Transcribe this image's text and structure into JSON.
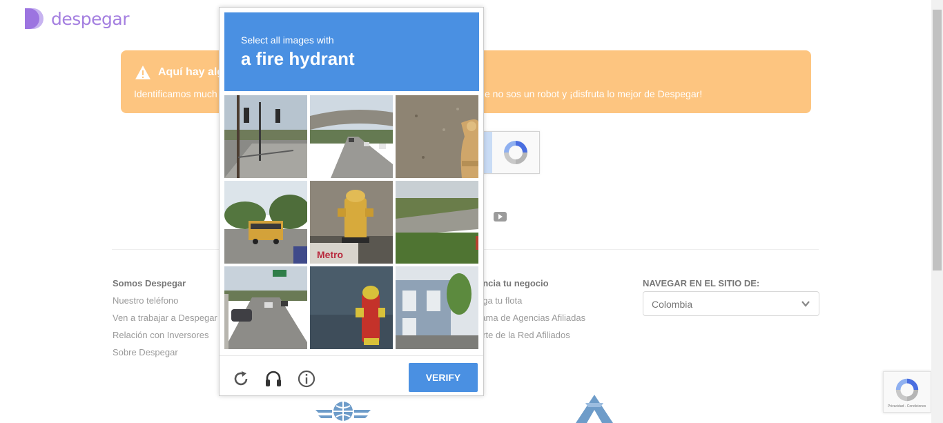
{
  "header": {
    "brand": "despegar",
    "brand_color": "#a47fe0"
  },
  "banner": {
    "title": "Aquí hay alg",
    "text_left": "Identificamos much",
    "text_right": "e no sos un robot y ¡disfruta lo mejor de Despegar!",
    "color": "#fdc580",
    "icon": "warning-icon"
  },
  "footer": {
    "col1": {
      "title": "Somos Despegar",
      "links": [
        "Nuestro teléfono",
        "Ven a trabajar a Despegar",
        "Relación con Inversores",
        "Sobre Despegar"
      ]
    },
    "col2": {
      "title": "encia tu negocio",
      "links": [
        "ega tu flota",
        "rama de Agencias Afiliadas",
        "arte de la Red Afiliados"
      ]
    },
    "col3": {
      "title": "NAVEGAR EN EL SITIO DE:",
      "select_value": "Colombia"
    }
  },
  "captcha": {
    "line1": "Select all images with",
    "line2": "a fire hydrant",
    "verify_label": "VERIFY",
    "tiles": [
      "street-intersection",
      "highway-overpass",
      "fire-hydrant-gravel",
      "school-bus",
      "yellow-fire-hydrant",
      "grass-roadside",
      "highway-cars",
      "red-fire-hydrant",
      "blue-house"
    ],
    "footer_icons": [
      "reload-icon",
      "audio-icon",
      "info-icon"
    ],
    "accent": "#4a90e2"
  },
  "recaptcha_badge": {
    "text": "Privacidad - Condiciones"
  }
}
